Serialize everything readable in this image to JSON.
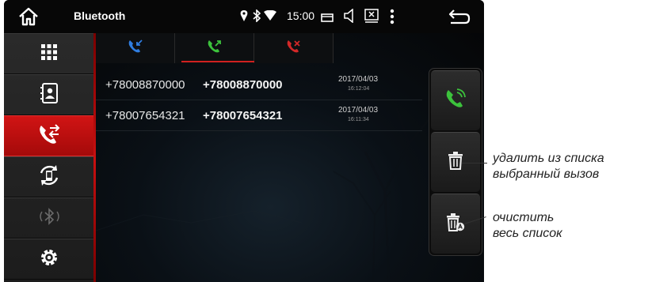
{
  "statusbar": {
    "title": "Bluetooth",
    "time": "15:00"
  },
  "sidebar": {
    "items": [
      {
        "icon": "grid-apps-icon",
        "active": false
      },
      {
        "icon": "contacts-book-icon",
        "active": false
      },
      {
        "icon": "call-log-icon",
        "active": true
      },
      {
        "icon": "sync-phone-icon",
        "active": false
      },
      {
        "icon": "bluetooth-icon",
        "active": false
      },
      {
        "icon": "gear-icon",
        "active": false
      }
    ]
  },
  "tabs": [
    {
      "icon": "incoming-call-icon",
      "color": "#2f7de0"
    },
    {
      "icon": "outgoing-call-icon",
      "color": "#3cc23c",
      "selected": true
    },
    {
      "icon": "missed-call-icon",
      "color": "#d22828"
    }
  ],
  "calls": [
    {
      "name": "+78008870000",
      "number": "+78008870000",
      "date": "2017/04/03",
      "time": "16:12:04"
    },
    {
      "name": "+78007654321",
      "number": "+78007654321",
      "date": "2017/04/03",
      "time": "16:11:34"
    }
  ],
  "actions": [
    {
      "icon": "call-icon",
      "color": "#3cc23c"
    },
    {
      "icon": "trash-icon",
      "color": "#e8e8e8"
    },
    {
      "icon": "trash-all-icon",
      "color": "#e8e8e8"
    }
  ],
  "annotations": {
    "delete_line1": "удалить из списка",
    "delete_line2": "выбранный вызов",
    "clear_line1": "очистить",
    "clear_line2": "весь список"
  }
}
